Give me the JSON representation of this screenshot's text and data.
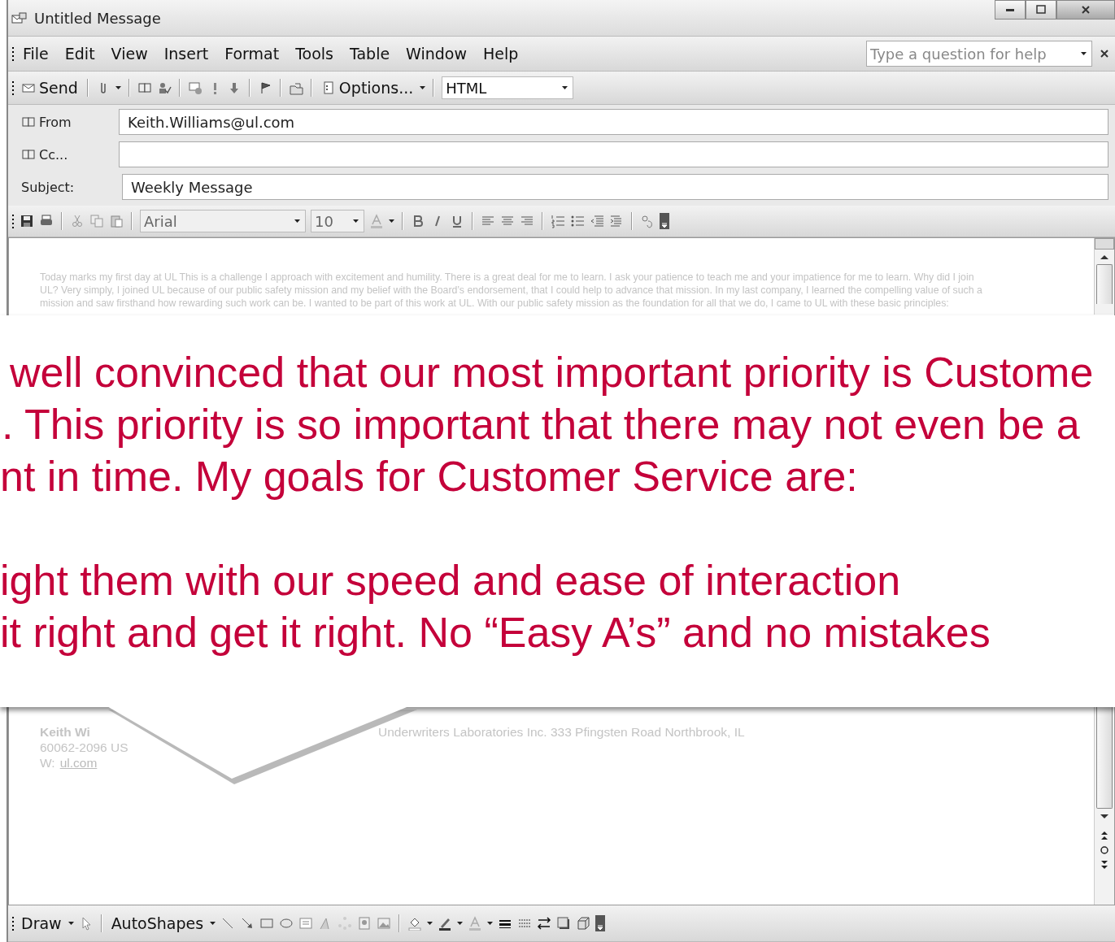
{
  "window": {
    "title": "Untitled Message"
  },
  "menu": {
    "items": [
      "File",
      "Edit",
      "View",
      "Insert",
      "Format",
      "Tools",
      "Table",
      "Window",
      "Help"
    ],
    "help_box": {
      "placeholder": "Type a question for help"
    }
  },
  "toolbar": {
    "send": "Send",
    "options": "Options...",
    "format": "HTML"
  },
  "fields": [
    {
      "label": "From",
      "kind": "button",
      "value": "Keith.Williams@ul.com"
    },
    {
      "label": "Cc...",
      "kind": "button"
    },
    {
      "label": "Subject:",
      "kind": "label",
      "value": "Weekly Message"
    }
  ],
  "format_toolbar": {
    "font": "Arial",
    "size": "10"
  },
  "body": {
    "lines": [
      "Today marks my first day at UL This is a challenge I approach with excitement and humility.  There is a great deal for me to learn. I ask your patience to teach me and your impatience for me to learn. Why did I join",
      "UL? Very simply,  I joined UL because of our public safety mission and my belief with the Board’s endorsement, that I could help to advance that mission. In my last company, I learned the compelling value of such a",
      "mission and saw firsthand how rewarding such work can be. I wanted to be part of this work at UL.  With our public safety mission as the foundation for all that we do, I came to UL with these basic principles:"
    ],
    "signature": {
      "name": "Keith Wi",
      "company": "Underwriters  Laboratories Inc.  333 Pfingsten Road  Northbrook, IL",
      "zip": "60062-2096 US",
      "web_label": "W:",
      "web_link": "ul.com"
    }
  },
  "callout": {
    "paragraphs": [
      [
        "well convinced that our most important priority is Custome",
        ". This priority is so important that there may not even be a",
        "nt in time. My goals for Customer Service are:"
      ],
      [
        "ight them with our speed and ease of interaction",
        "it right and get it right. No “Easy A’s” and no mistakes"
      ]
    ]
  },
  "draw_toolbar": {
    "draw": "Draw",
    "autoshapes": "AutoShapes"
  }
}
